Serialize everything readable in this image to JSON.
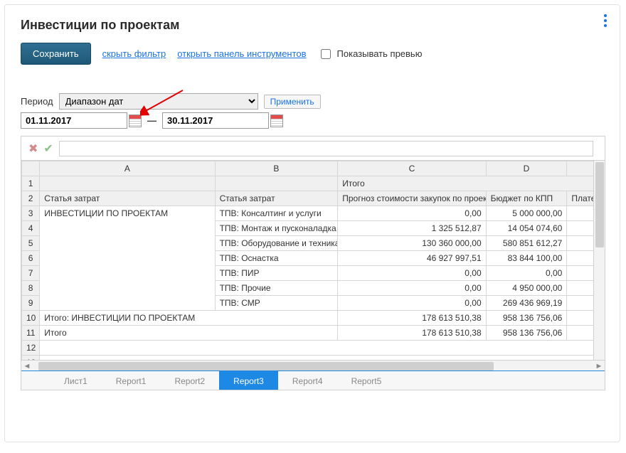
{
  "header": {
    "title": "Инвестиции по проектам"
  },
  "toolbar": {
    "save_label": "Сохранить",
    "hide_filter": "скрыть фильтр",
    "open_tools": "открыть панель инструментов",
    "show_preview": "Показывать превью"
  },
  "period": {
    "label": "Период",
    "select_value": "Диапазон дат",
    "apply_label": "Применить",
    "date_from": "01.11.2017",
    "separator": "—",
    "date_to": "30.11.2017"
  },
  "sheet": {
    "formula_value": "",
    "headers": {
      "A": "A",
      "B": "B",
      "C": "C",
      "D": "D",
      "E": ""
    },
    "row1": {
      "c": "Итого"
    },
    "row2": {
      "a": "Статья затрат",
      "b": "Статья затрат",
      "c": "Прогноз стоимости закупок по проекту",
      "d": "Бюджет по КПП",
      "e": "Платежи по до"
    },
    "rows": [
      {
        "n": "3",
        "a": "ИНВЕСТИЦИИ ПО ПРОЕКТАМ",
        "b": "ТПВ: Консалтинг и услуги",
        "c": "0,00",
        "d": "5 000 000,00"
      },
      {
        "n": "4",
        "a": "",
        "b": "ТПВ: Монтаж и пусконаладка",
        "c": "1 325 512,87",
        "d": "14 054 074,60"
      },
      {
        "n": "5",
        "a": "",
        "b": "ТПВ: Оборудование и техника",
        "c": "130 360 000,00",
        "d": "580 851 612,27"
      },
      {
        "n": "6",
        "a": "",
        "b": "ТПВ: Оснастка",
        "c": "46 927 997,51",
        "d": "83 844 100,00"
      },
      {
        "n": "7",
        "a": "",
        "b": "ТПВ: ПИР",
        "c": "0,00",
        "d": "0,00"
      },
      {
        "n": "8",
        "a": "",
        "b": "ТПВ: Прочие",
        "c": "0,00",
        "d": "4 950 000,00"
      },
      {
        "n": "9",
        "a": "",
        "b": "ТПВ: СМР",
        "c": "0,00",
        "d": "269 436 969,19"
      }
    ],
    "row10": {
      "a": "Итого: ИНВЕСТИЦИИ ПО ПРОЕКТАМ",
      "c": "178 613 510,38",
      "d": "958 136 756,06"
    },
    "row11": {
      "a": "Итого",
      "c": "178 613 510,38",
      "d": "958 136 756,06"
    },
    "tabs": [
      "Лист1",
      "Report1",
      "Report2",
      "Report3",
      "Report4",
      "Report5"
    ],
    "active_tab_index": 3
  }
}
